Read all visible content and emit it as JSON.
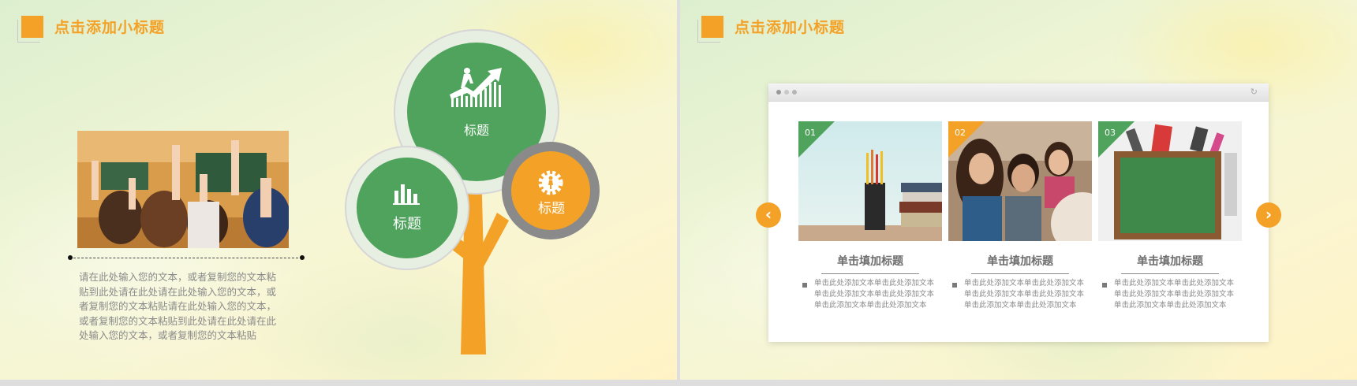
{
  "slide1": {
    "header": {
      "title": "点击添加小标题"
    },
    "paragraph": "请在此处输入您的文本，或者复制您的文本粘贴到此处请在此处请在此处输入您的文本，或者复制您的文本粘贴请在此处输入您的文本，或者复制您的文本粘贴到此处请在此处请在此处输入您的文本，或者复制您的文本粘贴",
    "tree": {
      "top_label": "标题",
      "left_label": "标题",
      "right_label": "标题"
    }
  },
  "slide2": {
    "header": {
      "title": "点击添加小标题"
    },
    "cards": [
      {
        "num": "01",
        "title": "单击填加标题",
        "text": "单击此处添加文本单击此处添加文本单击此处添加文本单击此处添加文本单击此添加文本单击此处添加文本",
        "accent": "#4fa35c"
      },
      {
        "num": "02",
        "title": "单击填加标题",
        "text": "单击此处添加文本单击此处添加文本单击此处添加文本单击此处添加文本单击此添加文本单击此处添加文本",
        "accent": "#f4a227"
      },
      {
        "num": "03",
        "title": "单击填加标题",
        "text": "单击此处添加文本单击此处添加文本单击此处添加文本单击此处添加文本单击此添加文本单击此处添加文本",
        "accent": "#4fa35c"
      }
    ],
    "prev_icon": "chevron-left-icon",
    "next_icon": "chevron-right-icon"
  },
  "colors": {
    "orange": "#f4a227",
    "green": "#4fa35c"
  }
}
